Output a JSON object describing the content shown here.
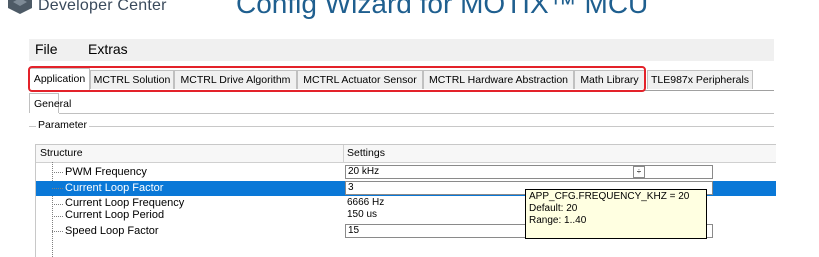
{
  "banner": {
    "brand": "Developer Center",
    "title": "Config Wizard for MOTIX™ MCU"
  },
  "menu": {
    "file": "File",
    "extras": "Extras"
  },
  "tabs": [
    {
      "label": "Application"
    },
    {
      "label": "MCTRL Solution"
    },
    {
      "label": "MCTRL Drive Algorithm"
    },
    {
      "label": "MCTRL Actuator Sensor"
    },
    {
      "label": "MCTRL Hardware Abstraction"
    },
    {
      "label": "Math Library"
    },
    {
      "label": "TLE987x Peripherals"
    }
  ],
  "subtab": "General",
  "group": "Parameter",
  "tree": {
    "col_structure": "Structure",
    "col_settings": "Settings",
    "rows": [
      {
        "name": "PWM Frequency",
        "value": "20 kHz"
      },
      {
        "name": "Current Loop Factor",
        "value": "3"
      },
      {
        "name": "Current Loop Frequency",
        "value": "6666 Hz"
      },
      {
        "name": "Current Loop Period",
        "value": "150 us"
      },
      {
        "name": "Speed Loop Factor",
        "value": "15"
      }
    ]
  },
  "tooltip": {
    "line1": "APP_CFG.FREQUENCY_KHZ = 20",
    "line2": "Default: 20",
    "line3": "Range: 1..40"
  },
  "colors": {
    "selection": "#0a78d7",
    "highlight_box": "#e3222a",
    "title": "#1f5f8f",
    "tooltip_bg": "#ffffe1"
  }
}
